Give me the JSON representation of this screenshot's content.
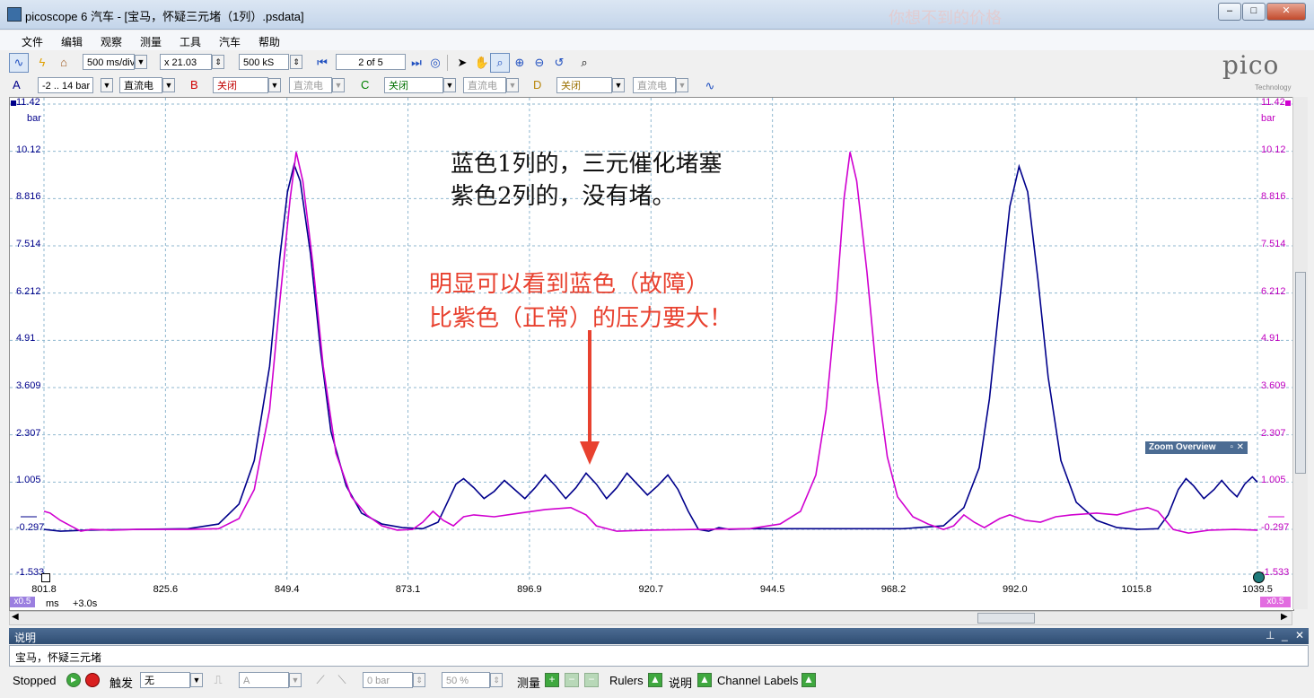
{
  "window": {
    "title": "picoscope 6 汽车 - [宝马，怀疑三元堵（1列）.psdata]",
    "watermark": "你想不到的价格"
  },
  "menu": [
    "文件",
    "编辑",
    "观察",
    "测量",
    "工具",
    "汽车",
    "帮助"
  ],
  "toolbar1": {
    "timebase": "500 ms/div",
    "zoom": "x 21.03",
    "samples": "500 kS",
    "buffer": "2 of 5"
  },
  "logo": {
    "main": "pico",
    "sub": "Technology"
  },
  "channels": [
    {
      "letter": "A",
      "range": "-2 .. 14 bar",
      "coupling": "直流电",
      "color": "#00008b"
    },
    {
      "letter": "B",
      "range": "关闭",
      "coupling": "直流电",
      "color": "#d000d0"
    },
    {
      "letter": "C",
      "range": "关闭",
      "coupling": "直流电",
      "color": "#008000"
    },
    {
      "letter": "D",
      "range": "关闭",
      "coupling": "直流电",
      "color": "#b8860b"
    }
  ],
  "chart_data": {
    "type": "line",
    "yticks": [
      "11.42",
      "10.12",
      "8.816",
      "7.514",
      "6.212",
      "4.91",
      "3.609",
      "2.307",
      "1.005",
      "-0.297",
      "-1.533"
    ],
    "ylabel": "bar",
    "ylim": [
      -1.533,
      11.42
    ],
    "xticks": [
      "801.8",
      "825.6",
      "849.4",
      "873.1",
      "896.9",
      "920.7",
      "944.5",
      "968.2",
      "992.0",
      "1015.8",
      "1039.5"
    ],
    "xlabel": "ms",
    "xlim": [
      801.8,
      1039.5
    ],
    "x_offset_label": "+3.0s",
    "y_scale_label": "x0.5",
    "series": [
      {
        "color": "#00008b",
        "points": [
          [
            801.8,
            -0.3
          ],
          [
            805,
            -0.35
          ],
          [
            810,
            -0.32
          ],
          [
            820,
            -0.3
          ],
          [
            830,
            -0.28
          ],
          [
            836,
            -0.15
          ],
          [
            840,
            0.4
          ],
          [
            843,
            1.6
          ],
          [
            846,
            4.2
          ],
          [
            848,
            7.2
          ],
          [
            849.5,
            9.0
          ],
          [
            850.8,
            9.75
          ],
          [
            852,
            9.3
          ],
          [
            854,
            7.3
          ],
          [
            856,
            4.6
          ],
          [
            858,
            2.4
          ],
          [
            861,
            0.9
          ],
          [
            864,
            0.15
          ],
          [
            868,
            -0.15
          ],
          [
            872,
            -0.25
          ],
          [
            876,
            -0.28
          ],
          [
            879,
            -0.1
          ],
          [
            881,
            0.5
          ],
          [
            882.5,
            0.95
          ],
          [
            884,
            1.1
          ],
          [
            886,
            0.85
          ],
          [
            888,
            0.55
          ],
          [
            890,
            0.75
          ],
          [
            892,
            1.05
          ],
          [
            894,
            0.8
          ],
          [
            896,
            0.55
          ],
          [
            898,
            0.85
          ],
          [
            900,
            1.2
          ],
          [
            902,
            0.9
          ],
          [
            904,
            0.55
          ],
          [
            906,
            0.85
          ],
          [
            908,
            1.25
          ],
          [
            910,
            0.95
          ],
          [
            912,
            0.55
          ],
          [
            914,
            0.85
          ],
          [
            916,
            1.25
          ],
          [
            918,
            0.95
          ],
          [
            920,
            0.65
          ],
          [
            922,
            0.9
          ],
          [
            924,
            1.2
          ],
          [
            926,
            0.8
          ],
          [
            928,
            0.2
          ],
          [
            930,
            -0.3
          ],
          [
            932,
            -0.35
          ],
          [
            934,
            -0.25
          ],
          [
            936,
            -0.3
          ],
          [
            940,
            -0.28
          ],
          [
            950,
            -0.28
          ],
          [
            960,
            -0.28
          ],
          [
            970,
            -0.28
          ],
          [
            978,
            -0.2
          ],
          [
            982,
            0.3
          ],
          [
            985,
            1.4
          ],
          [
            987,
            3.3
          ],
          [
            989,
            6.0
          ],
          [
            991,
            8.6
          ],
          [
            992.8,
            9.7
          ],
          [
            994.5,
            9.0
          ],
          [
            996.5,
            6.6
          ],
          [
            998.5,
            3.9
          ],
          [
            1001,
            1.6
          ],
          [
            1004,
            0.45
          ],
          [
            1008,
            -0.05
          ],
          [
            1012,
            -0.25
          ],
          [
            1016,
            -0.3
          ],
          [
            1020,
            -0.28
          ],
          [
            1022,
            0.1
          ],
          [
            1024,
            0.8
          ],
          [
            1025.5,
            1.1
          ],
          [
            1027,
            0.9
          ],
          [
            1029,
            0.55
          ],
          [
            1031,
            0.8
          ],
          [
            1032.5,
            1.05
          ],
          [
            1034,
            0.8
          ],
          [
            1035.5,
            0.6
          ],
          [
            1037,
            0.95
          ],
          [
            1038.5,
            1.15
          ],
          [
            1039.5,
            1.0
          ]
        ]
      },
      {
        "color": "#d000d0",
        "points": [
          [
            801.8,
            0.2
          ],
          [
            803,
            0.15
          ],
          [
            805,
            -0.05
          ],
          [
            807,
            -0.2
          ],
          [
            809,
            -0.35
          ],
          [
            811,
            -0.3
          ],
          [
            815,
            -0.32
          ],
          [
            820,
            -0.3
          ],
          [
            830,
            -0.3
          ],
          [
            836,
            -0.28
          ],
          [
            840,
            0.0
          ],
          [
            843,
            0.8
          ],
          [
            846,
            3.0
          ],
          [
            848,
            6.0
          ],
          [
            850,
            8.8
          ],
          [
            851.2,
            10.1
          ],
          [
            852.5,
            9.3
          ],
          [
            854.5,
            7.0
          ],
          [
            856.5,
            4.2
          ],
          [
            859,
            1.8
          ],
          [
            862,
            0.6
          ],
          [
            865,
            0.1
          ],
          [
            868,
            -0.2
          ],
          [
            871,
            -0.32
          ],
          [
            874,
            -0.3
          ],
          [
            876,
            -0.1
          ],
          [
            878,
            0.2
          ],
          [
            880,
            -0.05
          ],
          [
            882,
            -0.2
          ],
          [
            884,
            0.05
          ],
          [
            886,
            0.1
          ],
          [
            890,
            0.05
          ],
          [
            895,
            0.15
          ],
          [
            900,
            0.25
          ],
          [
            905,
            0.3
          ],
          [
            908,
            0.1
          ],
          [
            910,
            -0.2
          ],
          [
            914,
            -0.35
          ],
          [
            920,
            -0.32
          ],
          [
            930,
            -0.3
          ],
          [
            940,
            -0.28
          ],
          [
            946,
            -0.15
          ],
          [
            950,
            0.2
          ],
          [
            953,
            1.2
          ],
          [
            955,
            3.0
          ],
          [
            957,
            6.0
          ],
          [
            958.5,
            8.8
          ],
          [
            959.7,
            10.1
          ],
          [
            961,
            9.3
          ],
          [
            963,
            6.8
          ],
          [
            965,
            3.8
          ],
          [
            967,
            1.7
          ],
          [
            969,
            0.6
          ],
          [
            972,
            0.05
          ],
          [
            975,
            -0.15
          ],
          [
            978,
            -0.3
          ],
          [
            980,
            -0.2
          ],
          [
            982,
            0.1
          ],
          [
            984,
            -0.1
          ],
          [
            986,
            -0.25
          ],
          [
            989,
            0.0
          ],
          [
            991,
            0.1
          ],
          [
            994,
            -0.05
          ],
          [
            997,
            -0.1
          ],
          [
            1000,
            0.05
          ],
          [
            1003,
            0.1
          ],
          [
            1008,
            0.15
          ],
          [
            1012,
            0.1
          ],
          [
            1016,
            0.25
          ],
          [
            1018,
            0.3
          ],
          [
            1020,
            0.2
          ],
          [
            1023,
            -0.3
          ],
          [
            1026,
            -0.4
          ],
          [
            1030,
            -0.32
          ],
          [
            1035,
            -0.3
          ],
          [
            1039.5,
            -0.32
          ]
        ]
      }
    ],
    "annotations": [
      {
        "text": "蓝色1列的，三元催化堵塞",
        "color": "#111111"
      },
      {
        "text": "紫色2列的，没有堵。",
        "color": "#111111"
      },
      {
        "text": "明显可以看到蓝色（故障）",
        "color": "#e8412f"
      },
      {
        "text": "比紫色（正常）的压力要大！",
        "color": "#e8412f"
      }
    ]
  },
  "zoom_overview": "Zoom Overview",
  "info_panel": {
    "title": "说明",
    "text": "宝马，怀疑三元堵"
  },
  "status": {
    "state": "Stopped",
    "trigger_label": "触发",
    "trigger_mode": "无",
    "trigger_channel": "A",
    "threshold": "0 bar",
    "pretrigger": "50 %",
    "measure_label": "测量",
    "rulers_label": "Rulers",
    "notes_label": "说明",
    "channel_labels": "Channel Labels"
  }
}
